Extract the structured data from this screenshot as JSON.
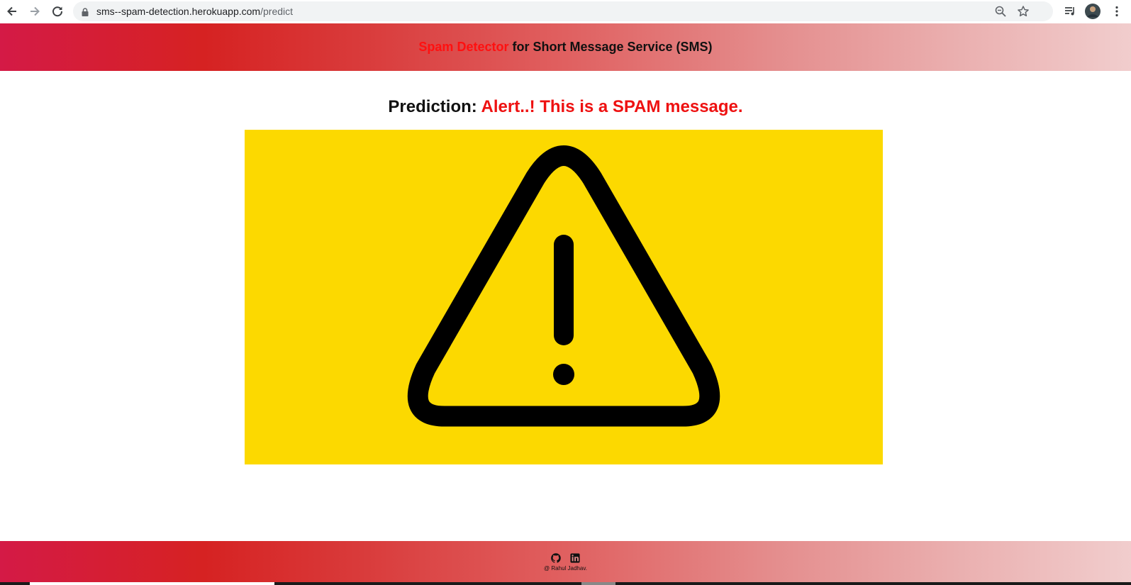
{
  "browser": {
    "url_host": "sms--spam-detection.herokuapp.com",
    "url_path": "/predict",
    "icons": [
      "back-arrow-icon",
      "forward-arrow-icon",
      "reload-icon",
      "lock-icon",
      "zoom-icon",
      "star-icon",
      "media-queue-icon",
      "avatar",
      "more-vert-icon"
    ]
  },
  "header": {
    "title_accent": "Spam Detector",
    "title_rest": " for Short Message Service (SMS)"
  },
  "main": {
    "prediction_label": "Prediction: ",
    "prediction_result": "Alert..! This is a SPAM message.",
    "image_icon": "warning-triangle-icon",
    "image_background": "#fcd900"
  },
  "footer": {
    "icons": [
      "github-icon",
      "linkedin-icon"
    ],
    "credit": "@ Rahul Jadhav."
  },
  "colors": {
    "accent_red": "#ff1010",
    "header_gradient_start": "#d41a46",
    "header_gradient_end": "#f1cdcd"
  }
}
